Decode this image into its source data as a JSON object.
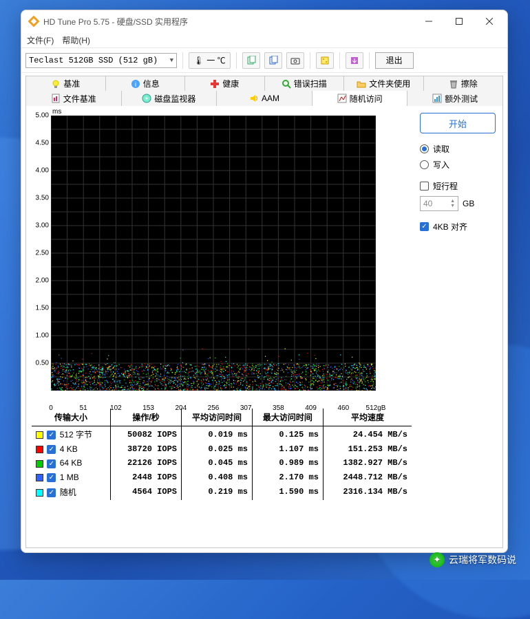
{
  "window": {
    "title": "HD Tune Pro 5.75 - 硬盘/SSD 实用程序"
  },
  "menu": {
    "file": "文件(F)",
    "help": "帮助(H)"
  },
  "toolbar": {
    "device": "Teclast 512GB SSD (512 gB)",
    "temp": "一 ℃",
    "exit": "退出"
  },
  "tabs": {
    "row1": [
      {
        "label": "基准",
        "icon": "bulb"
      },
      {
        "label": "信息",
        "icon": "info"
      },
      {
        "label": "健康",
        "icon": "plus"
      },
      {
        "label": "错误扫描",
        "icon": "search"
      },
      {
        "label": "文件夹使用",
        "icon": "folder"
      },
      {
        "label": "擦除",
        "icon": "trash"
      }
    ],
    "row2": [
      {
        "label": "文件基准",
        "icon": "filebench"
      },
      {
        "label": "磁盘监视器",
        "icon": "disk"
      },
      {
        "label": "AAM",
        "icon": "sound"
      },
      {
        "label": "随机访问",
        "icon": "random",
        "active": true
      },
      {
        "label": "额外测试",
        "icon": "extra"
      }
    ]
  },
  "controls": {
    "start": "开始",
    "read": "读取",
    "write": "写入",
    "short_stroke": "短行程",
    "short_value": "40",
    "short_unit": "GB",
    "align": "4KB 对齐"
  },
  "chart": {
    "y_unit": "ms",
    "y_ticks": [
      "5.00",
      "4.50",
      "4.00",
      "3.50",
      "3.00",
      "2.50",
      "2.00",
      "1.50",
      "1.00",
      "0.50"
    ],
    "x_ticks": [
      "0",
      "51",
      "102",
      "153",
      "204",
      "256",
      "307",
      "358",
      "409",
      "460",
      "512gB"
    ]
  },
  "table": {
    "headers": [
      "传输大小",
      "操作/秒",
      "平均访问时间",
      "最大访问时间",
      "平均速度"
    ],
    "rows": [
      {
        "color": "#ffff00",
        "label": "512 字节",
        "iops": "50082 IOPS",
        "avg": "0.019 ms",
        "max": "0.125 ms",
        "speed": "24.454 MB/s"
      },
      {
        "color": "#ff0000",
        "label": "4 KB",
        "iops": "38720 IOPS",
        "avg": "0.025 ms",
        "max": "1.107 ms",
        "speed": "151.253 MB/s"
      },
      {
        "color": "#00cc00",
        "label": "64 KB",
        "iops": "22126 IOPS",
        "avg": "0.045 ms",
        "max": "0.989 ms",
        "speed": "1382.927 MB/s"
      },
      {
        "color": "#3060ff",
        "label": "1 MB",
        "iops": "2448 IOPS",
        "avg": "0.408 ms",
        "max": "2.170 ms",
        "speed": "2448.712 MB/s"
      },
      {
        "color": "#00ffff",
        "label": "随机",
        "iops": "4564 IOPS",
        "avg": "0.219 ms",
        "max": "1.590 ms",
        "speed": "2316.134 MB/s"
      }
    ]
  },
  "watermark": "云瑞将军数码说",
  "chart_data": {
    "type": "scatter",
    "title": "随机访问",
    "xlabel": "gB",
    "ylabel": "ms",
    "xlim": [
      0,
      512
    ],
    "ylim": [
      0,
      5.0
    ],
    "note": "Dense scatter of access times clustered near 0–0.5 ms across full 0–512 gB range; series correspond to 512字节 / 4KB / 64KB / 1MB / 随机 with colors shown in legend.",
    "series": [
      {
        "name": "512 字节",
        "color": "#ffff00",
        "avg_ms": 0.019,
        "max_ms": 0.125
      },
      {
        "name": "4 KB",
        "color": "#ff0000",
        "avg_ms": 0.025,
        "max_ms": 1.107
      },
      {
        "name": "64 KB",
        "color": "#00cc00",
        "avg_ms": 0.045,
        "max_ms": 0.989
      },
      {
        "name": "1 MB",
        "color": "#3060ff",
        "avg_ms": 0.408,
        "max_ms": 2.17
      },
      {
        "name": "随机",
        "color": "#00ffff",
        "avg_ms": 0.219,
        "max_ms": 1.59
      }
    ]
  }
}
